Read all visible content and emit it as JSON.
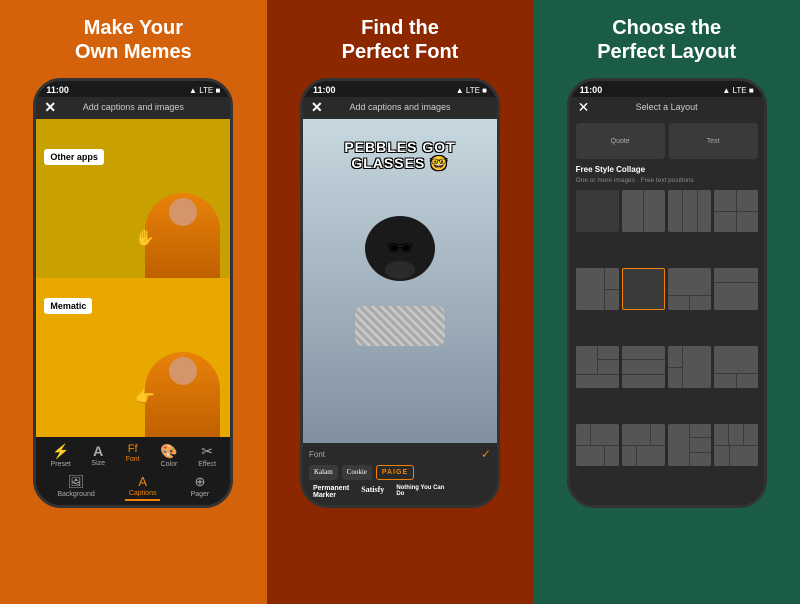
{
  "panel1": {
    "title": "Make Your\nOwn Memes",
    "status": {
      "time": "11:00",
      "signal": "▲ LTE ■"
    },
    "nav": {
      "title": "Add captions\nand images"
    },
    "meme": {
      "other_apps": "Other apps",
      "mematic": "Mematic"
    },
    "toolbar": {
      "icons": [
        "⚡",
        "A",
        "Ff",
        "🎨",
        "✂"
      ],
      "icon_labels": [
        "Preset",
        "Size",
        "Font",
        "Color",
        "Effect"
      ],
      "tabs": [
        "Background",
        "Captions",
        "Pager"
      ],
      "active_tab": "Captions"
    }
  },
  "panel2": {
    "title": "Find the\nPerfect Font",
    "status": {
      "time": "11:00",
      "signal": "▲ LTE ■"
    },
    "nav": {
      "title": "Add captions\nand images"
    },
    "meme_text": "PEBBLES GOT GLASSES 🤓",
    "toolbar": {
      "label": "Font",
      "fonts": [
        "Kalam",
        "Cookie",
        "PAIGE"
      ],
      "active_font": "PAIGE",
      "fonts_row2": [
        "Permanent\nMarker",
        "Satisfy",
        "Nothing You Can\nDo"
      ]
    }
  },
  "panel3": {
    "title": "Choose the\nPerfect Layout",
    "status": {
      "time": "11:00",
      "signal": "▲ LTE ■"
    },
    "nav": {
      "title": "Select a Layout"
    },
    "layout": {
      "top_items": [
        "Quote",
        "Text"
      ],
      "section_label": "Free Style Collage",
      "section_sub": "One or more images · Free text positions"
    }
  }
}
